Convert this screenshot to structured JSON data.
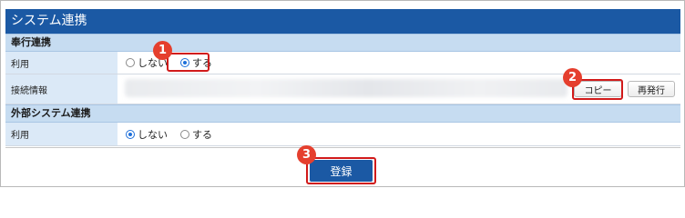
{
  "panel": {
    "title": "システム連携"
  },
  "bugyo_section": {
    "title": "奉行連携",
    "usage": {
      "label": "利用",
      "options": [
        {
          "label": "しない",
          "selected": false
        },
        {
          "label": "する",
          "selected": true
        }
      ]
    },
    "connection": {
      "label": "接続情報",
      "copy_label": "コピー",
      "reissue_label": "再発行"
    }
  },
  "external_section": {
    "title": "外部システム連携",
    "usage": {
      "label": "利用",
      "options": [
        {
          "label": "しない",
          "selected": true
        },
        {
          "label": "する",
          "selected": false
        }
      ]
    }
  },
  "submit_label": "登録",
  "callouts": [
    "1",
    "2",
    "3"
  ],
  "colors": {
    "header": "#1b59a4",
    "section": "#c6dcf1",
    "label_cell": "#dbe9f7",
    "highlight": "#d11a1a",
    "badge": "#e53f2e"
  }
}
